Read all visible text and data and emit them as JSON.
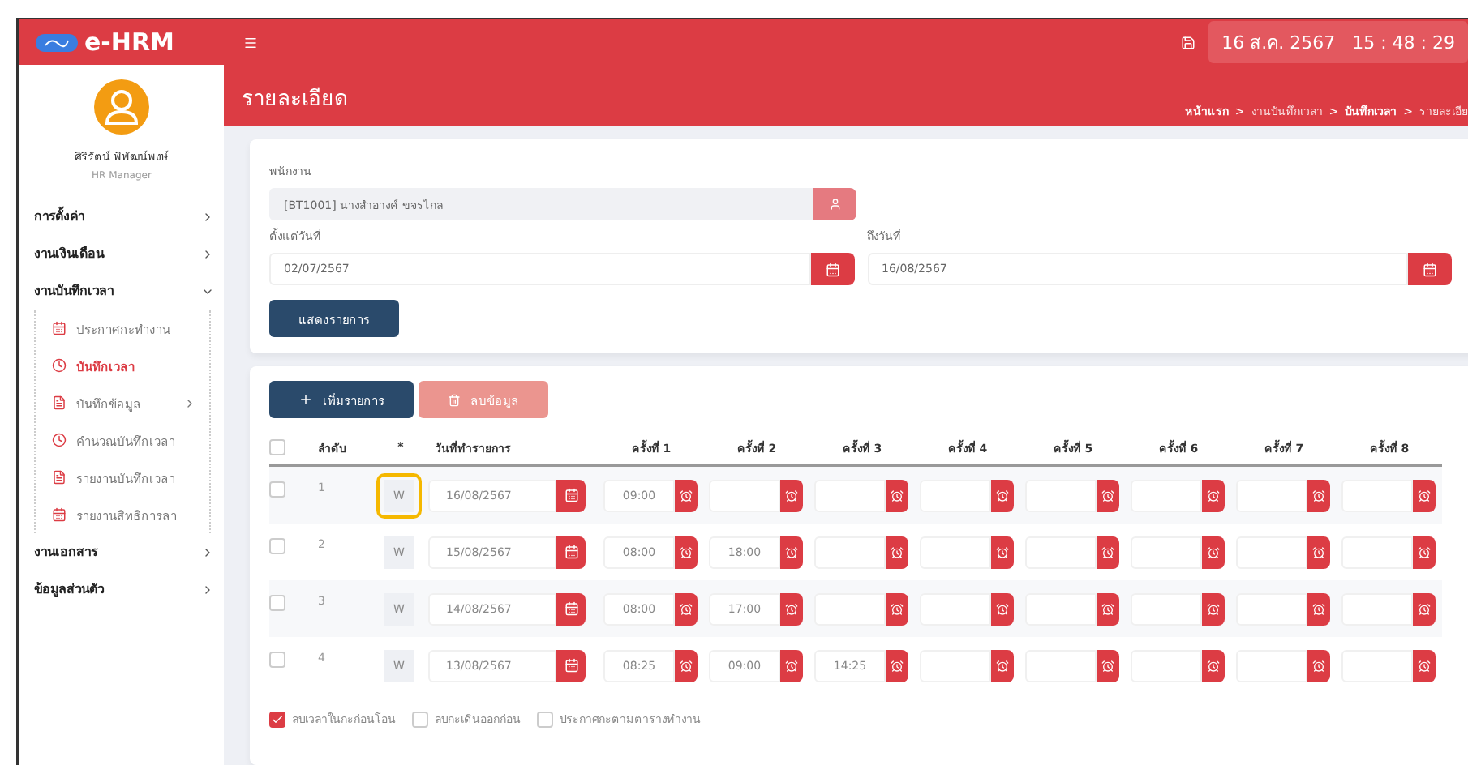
{
  "header": {
    "brand": "e-HRM",
    "datetime": "16 ส.ค. 2567   15 : 48 : 29"
  },
  "sidebar": {
    "user": {
      "name": "ศิริรัตน์ พิพัฒน์พงษ์",
      "role": "HR Manager"
    },
    "items": [
      {
        "label": "การตั้งค่า",
        "expanded": false
      },
      {
        "label": "งานเงินเดือน",
        "expanded": false
      },
      {
        "label": "งานบันทึกเวลา",
        "expanded": true,
        "children": [
          {
            "label": "ประกาศกะทำงาน",
            "kind": "calendar",
            "selected": false,
            "expandable": false
          },
          {
            "label": "บันทึกเวลา",
            "kind": "clock",
            "selected": true,
            "expandable": false
          },
          {
            "label": "บันทึกข้อมูล",
            "kind": "file",
            "selected": false,
            "expandable": true
          },
          {
            "label": "คำนวณบันทึกเวลา",
            "kind": "clock",
            "selected": false,
            "expandable": false
          },
          {
            "label": "รายงานบันทึกเวลา",
            "kind": "file",
            "selected": false,
            "expandable": false
          },
          {
            "label": "รายงานสิทธิการลา",
            "kind": "calendar",
            "selected": false,
            "expandable": false
          }
        ]
      },
      {
        "label": "งานเอกสาร",
        "expanded": false
      },
      {
        "label": "ข้อมูลส่วนตัว",
        "expanded": false
      }
    ]
  },
  "page": {
    "title": "รายละเอียด",
    "breadcrumb": [
      {
        "label": "หน้าแรก",
        "bold": true,
        "separator": ">"
      },
      {
        "label": "งานบันทึกเวลา",
        "bold": false,
        "separator": ">"
      },
      {
        "label": "บันทึกเวลา",
        "bold": true,
        "separator": ">"
      },
      {
        "label": "รายละเอีย",
        "bold": false
      }
    ]
  },
  "filter": {
    "employee": {
      "label": "พนักงาน",
      "value": "[BT1001] นางสำอางค์ ขจรไกล"
    },
    "from": {
      "label": "ตั้งแต่วันที่",
      "value": "02/07/2567"
    },
    "to": {
      "label": "ถึงวันที่",
      "value": "16/08/2567"
    },
    "button": "แสดงรายการ"
  },
  "table": {
    "add_button": "เพิ่มรายการ",
    "delete_button": {
      "label": "ลบข้อมูล",
      "disabled": true
    },
    "select_all": false,
    "columns": [
      "ลำดับ",
      "*",
      "วันที่ทำรายการ",
      "ครั้งที่ 1",
      "ครั้งที่ 2",
      "ครั้งที่ 3",
      "ครั้งที่ 4",
      "ครั้งที่ 5",
      "ครั้งที่ 6",
      "ครั้งที่ 7",
      "ครั้งที่ 8"
    ],
    "rows": [
      {
        "no": "1",
        "type": "W",
        "highlighted": true,
        "checked": false,
        "date": "16/08/2567",
        "times": [
          "09:00"
        ]
      },
      {
        "no": "2",
        "type": "W",
        "highlighted": false,
        "checked": false,
        "date": "15/08/2567",
        "times": [
          "08:00",
          "18:00"
        ]
      },
      {
        "no": "3",
        "type": "W",
        "highlighted": false,
        "checked": false,
        "date": "14/08/2567",
        "times": [
          "08:00",
          "17:00"
        ]
      },
      {
        "no": "4",
        "type": "W",
        "highlighted": false,
        "checked": false,
        "date": "13/08/2567",
        "times": [
          "08:25",
          "09:00",
          "14:25"
        ]
      }
    ],
    "options": [
      {
        "label": "ลบเวลาในกะก่อนโอน",
        "checked": true
      },
      {
        "label": "ลบกะเดินออกก่อน",
        "checked": false
      },
      {
        "label": "ประกาศกะตามตารางทำงาน",
        "checked": false
      }
    ]
  }
}
